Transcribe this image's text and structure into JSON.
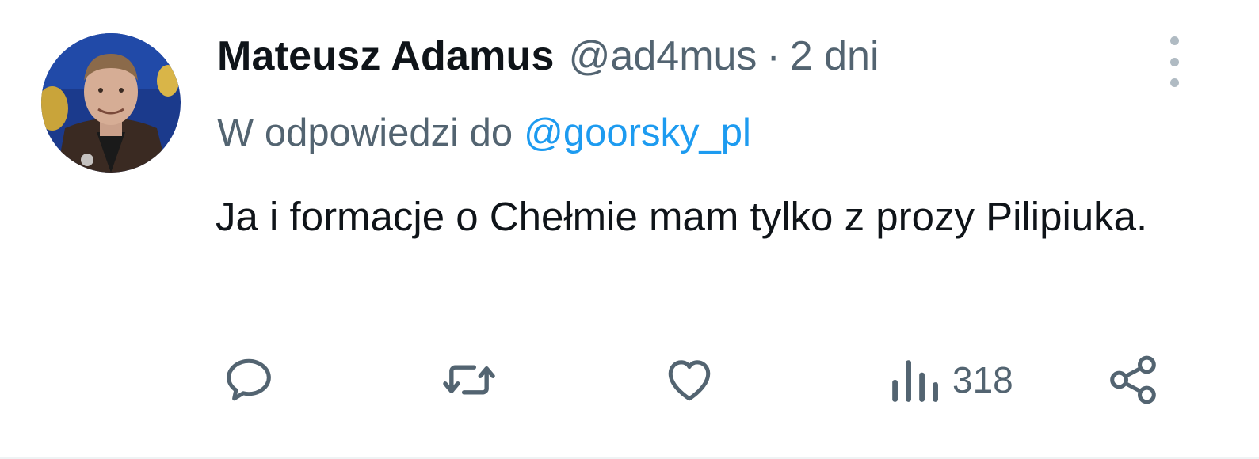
{
  "tweet": {
    "display_name": "Mateusz Adamus",
    "handle": "@ad4mus",
    "separator": "·",
    "time": "2 dni",
    "reply_prefix": "W odpowiedzi do",
    "reply_to": "@goorsky_pl",
    "text": "Ja i formacje o Chełmie mam tylko z prozy Pilipiuka."
  },
  "actions": {
    "views_count": "318"
  },
  "icons": {
    "more": "more-vertical-icon",
    "reply": "reply-icon",
    "retweet": "retweet-icon",
    "like": "heart-icon",
    "views": "views-icon",
    "share": "share-icon"
  },
  "colors": {
    "text_primary": "#0f1419",
    "text_secondary": "#536471",
    "link": "#1d9bf0",
    "icon": "#536471"
  }
}
